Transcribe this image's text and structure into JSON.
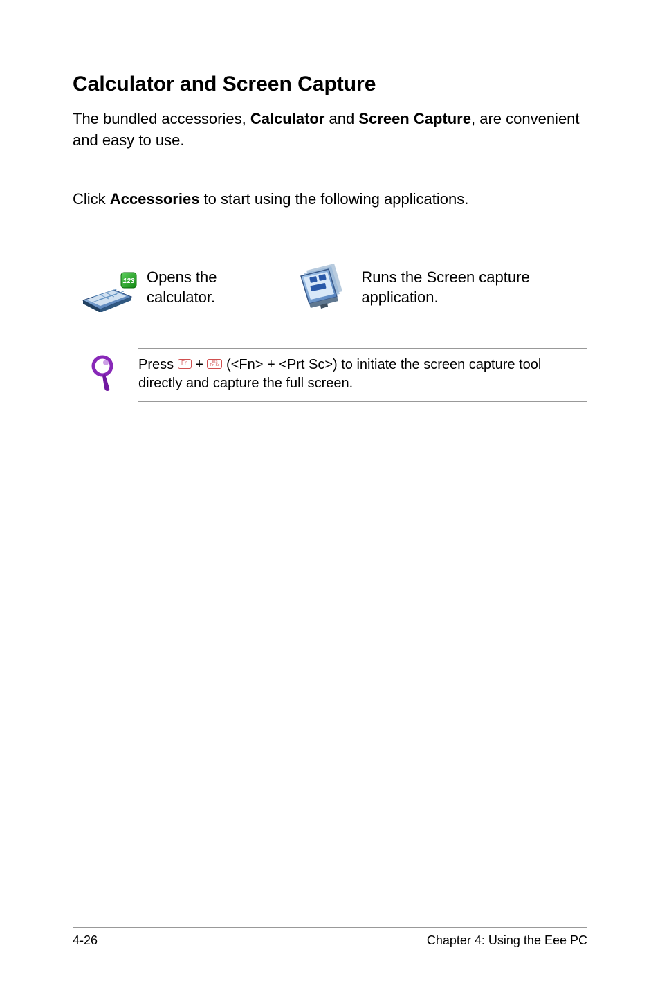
{
  "section": {
    "title": "Calculator and Screen Capture"
  },
  "intro": {
    "prefix": "The bundled accessories, ",
    "bold1": "Calculator",
    "mid": " and ",
    "bold2": "Screen Capture",
    "suffix": ", are convenient and easy to use."
  },
  "click": {
    "prefix": "Click ",
    "bold": "Accessories",
    "suffix": " to start using the following applications."
  },
  "apps": {
    "calc_desc": "Opens the calculator.",
    "capture_desc": "Runs the Screen capture application."
  },
  "note": {
    "press_text": "Press ",
    "key1": "Fn",
    "plus": " + ",
    "key2_top": "Ins",
    "key2_bot": "Prt Sc",
    "rest": " (<Fn> + <Prt Sc>) to initiate the screen capture tool directly and capture the full screen."
  },
  "footer": {
    "page": "4-26",
    "chapter": "Chapter 4: Using the Eee PC"
  }
}
